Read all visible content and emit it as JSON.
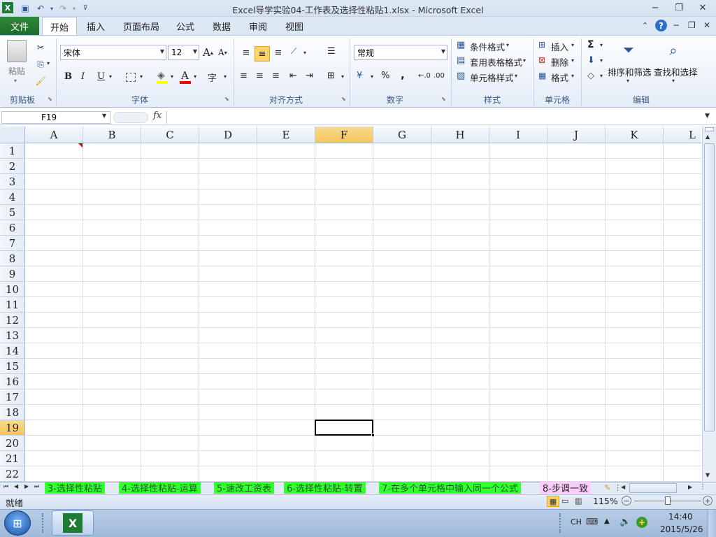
{
  "window": {
    "title": "Excel导学实验04-工作表及选择性粘贴1.xlsx - Microsoft Excel"
  },
  "tabs": {
    "file": "文件",
    "home": "开始",
    "insert": "插入",
    "page_layout": "页面布局",
    "formulas": "公式",
    "data": "数据",
    "review": "审阅",
    "view": "视图"
  },
  "ribbon": {
    "clipboard": {
      "paste": "粘贴",
      "label": "剪贴板"
    },
    "font": {
      "name": "宋体",
      "size": "12",
      "label": "字体",
      "bold": "B",
      "italic": "I",
      "underline": "U"
    },
    "alignment": {
      "label": "对齐方式"
    },
    "number": {
      "format": "常规",
      "label": "数字",
      "percent": "%",
      "comma": ","
    },
    "styles": {
      "conditional": "条件格式",
      "table": "套用表格格式",
      "cell": "单元格样式",
      "label": "样式"
    },
    "cells": {
      "insert": "插入",
      "delete": "删除",
      "format": "格式",
      "label": "单元格"
    },
    "editing": {
      "sort": "排序和筛选",
      "find": "查找和选择",
      "label": "编辑",
      "sigma": "Σ"
    }
  },
  "formula_bar": {
    "name_box": "F19",
    "fx": "fx",
    "value": ""
  },
  "grid": {
    "columns": [
      "A",
      "B",
      "C",
      "D",
      "E",
      "F",
      "G",
      "H",
      "I",
      "J",
      "K",
      "L"
    ],
    "rows": [
      "1",
      "2",
      "3",
      "4",
      "5",
      "6",
      "7",
      "8",
      "9",
      "10",
      "11",
      "12",
      "13",
      "14",
      "15",
      "16",
      "17",
      "18",
      "19",
      "20",
      "21",
      "22"
    ],
    "active_column": "F",
    "active_row": "19"
  },
  "sheets": [
    {
      "name": "3-选择性粘贴",
      "color": "#33ff33"
    },
    {
      "name": "4-选择性粘贴-运算",
      "color": "#33ff33"
    },
    {
      "name": "5-速改工资表",
      "color": "#33ff33"
    },
    {
      "name": "6-选择性粘贴-转置",
      "color": "#33ff33"
    },
    {
      "name": "7-在多个单元格中输入同一个公式",
      "color": "#33ff33"
    },
    {
      "name": "8-步调一致",
      "color": "#ffccff"
    }
  ],
  "status": {
    "ready": "就绪",
    "zoom": "115%"
  },
  "taskbar": {
    "lang": "CH",
    "time": "14:40",
    "date": "2015/5/26"
  }
}
